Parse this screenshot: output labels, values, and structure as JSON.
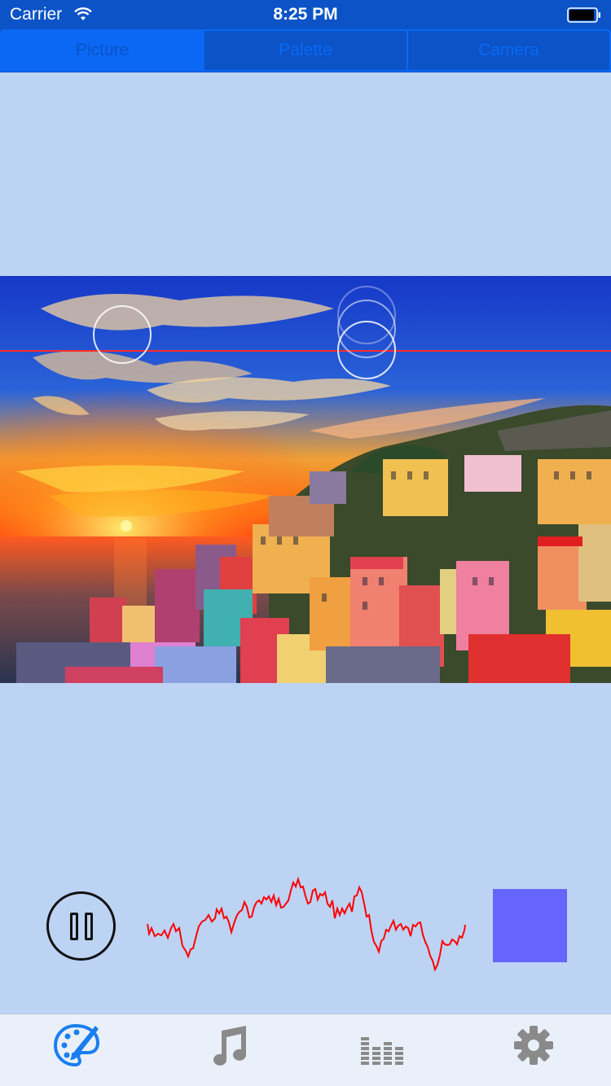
{
  "status_bar": {
    "carrier": "Carrier",
    "time": "8:25 PM"
  },
  "segments": [
    {
      "label": "Picture",
      "selected": true
    },
    {
      "label": "Palette",
      "selected": false
    },
    {
      "label": "Camera",
      "selected": false
    }
  ],
  "photo": {
    "description_icon": "sunset-town-photo"
  },
  "player": {
    "state": "playing",
    "swatch_color": "#6666ff"
  },
  "tab_bar": {
    "items": [
      {
        "icon": "palette-icon",
        "active": true
      },
      {
        "icon": "music-note-icon",
        "active": false
      },
      {
        "icon": "equalizer-icon",
        "active": false
      },
      {
        "icon": "gear-icon",
        "active": false
      }
    ]
  },
  "colors": {
    "accent": "#0a68f5",
    "nav_bar": "#0b53c6",
    "background": "#bdd3f4",
    "waveform": "#ff0000",
    "scanline": "#ff2a2a"
  }
}
